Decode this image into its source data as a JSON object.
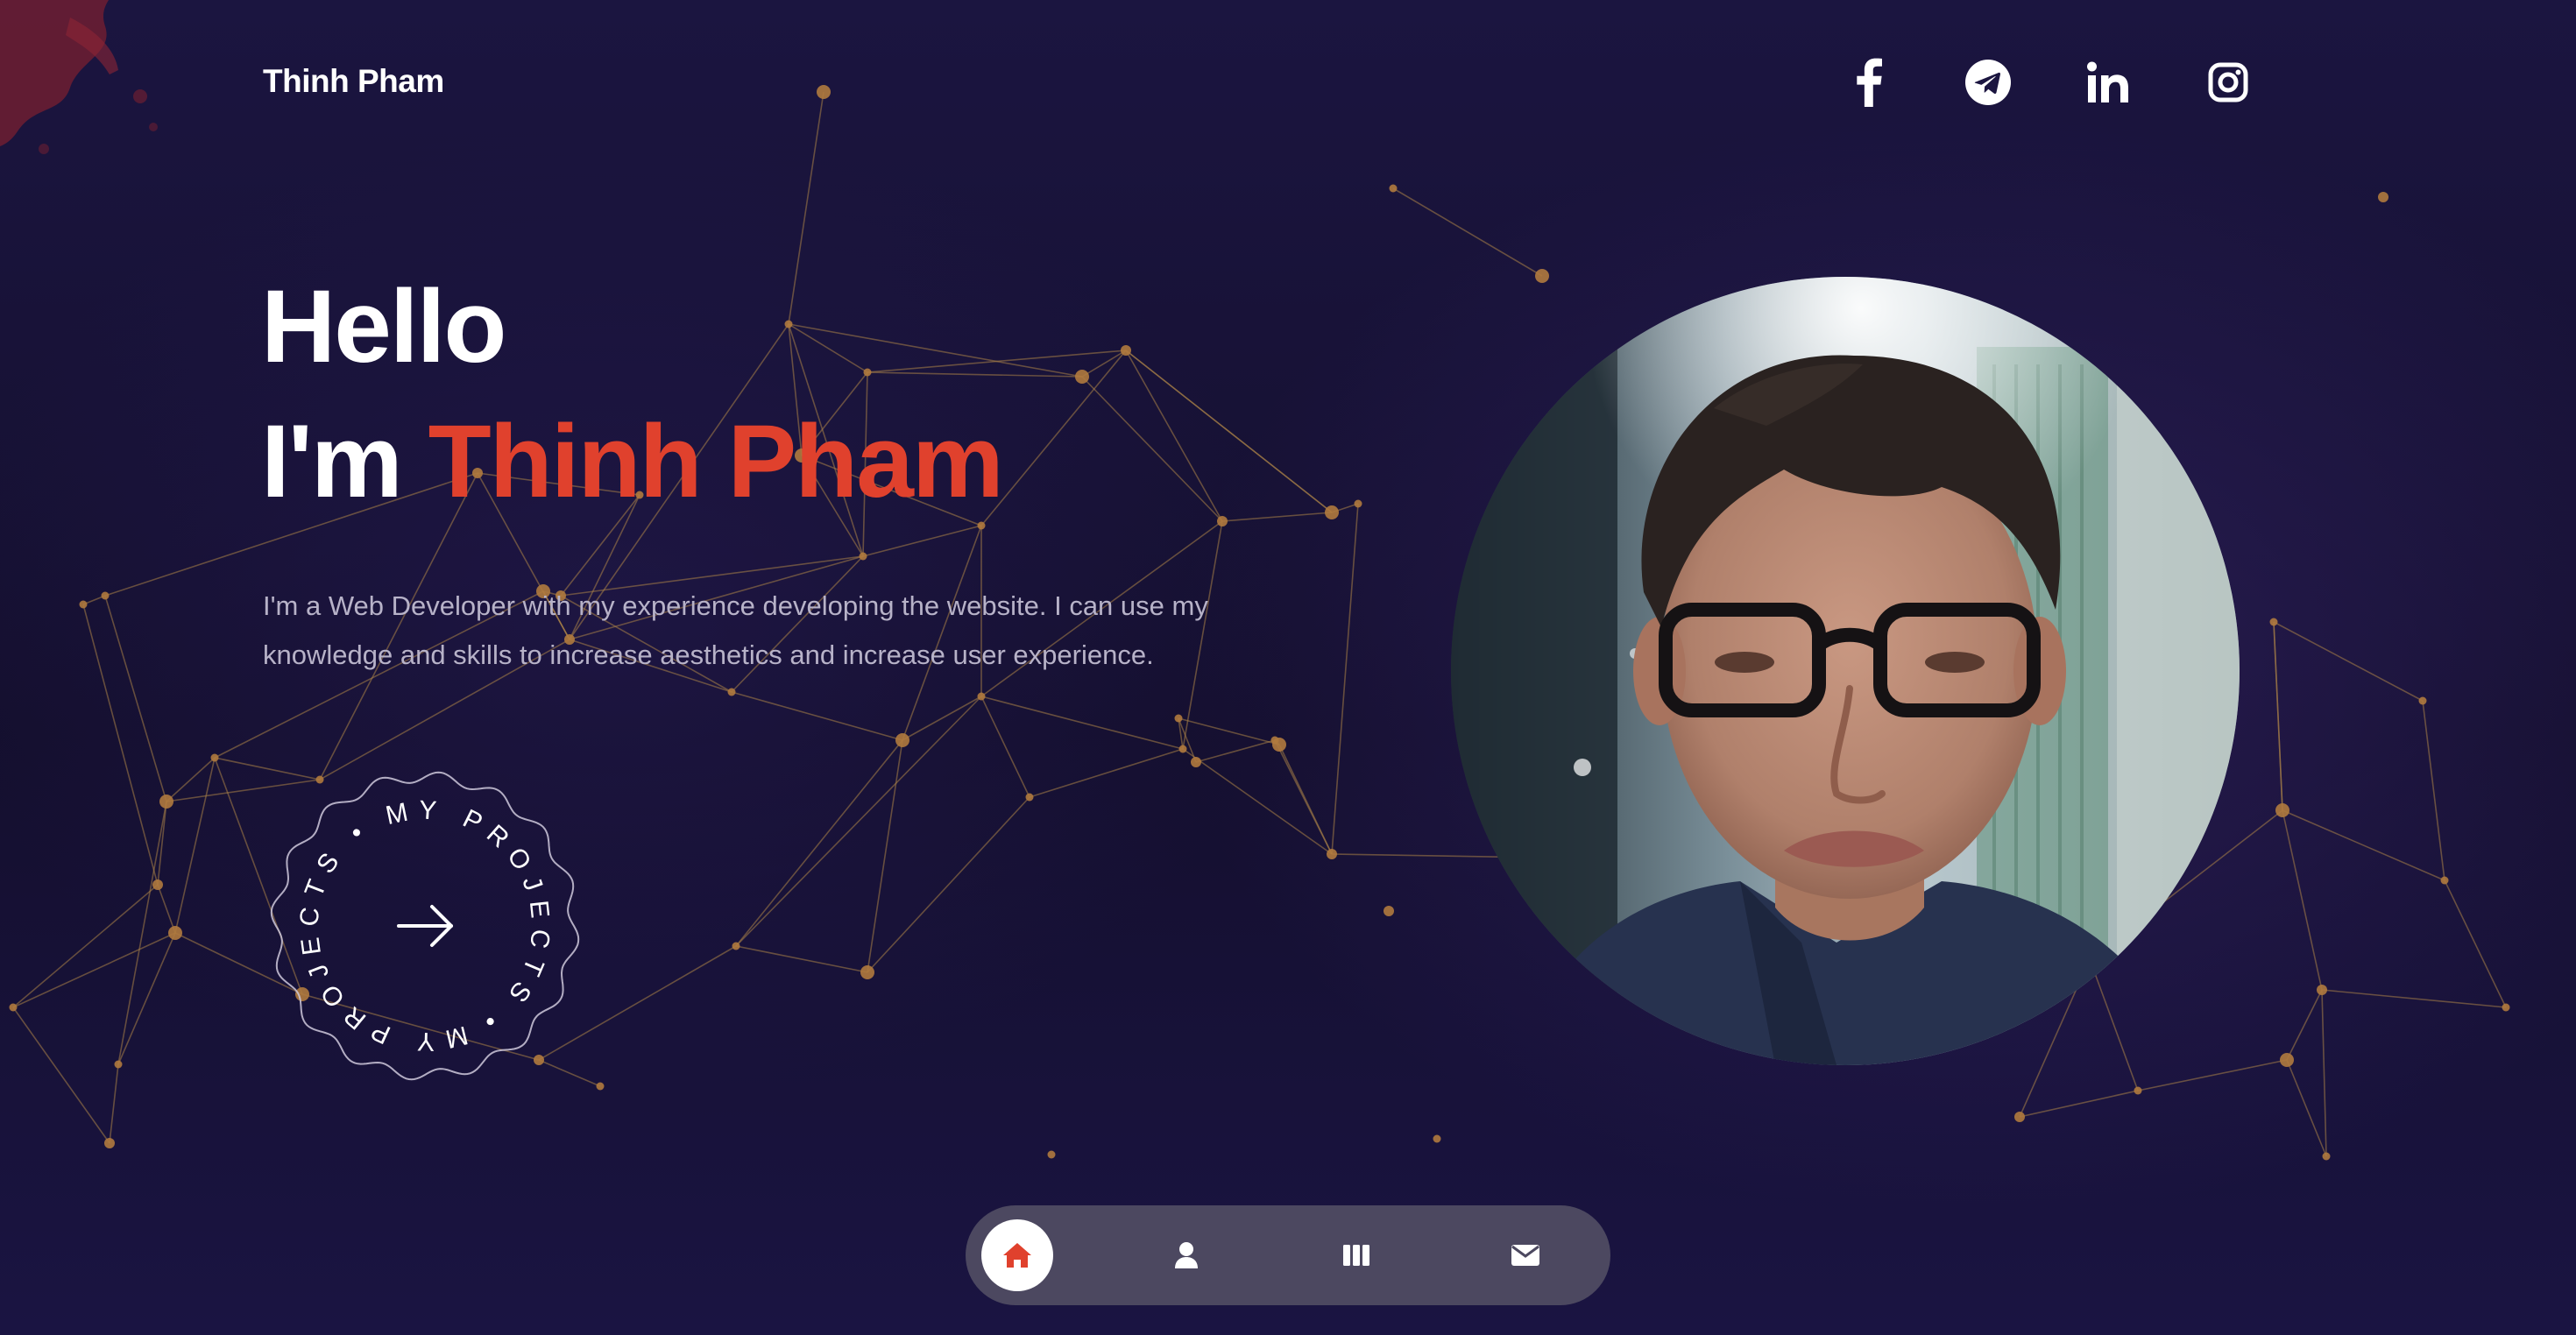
{
  "header": {
    "brand": "Thinh Pham",
    "social": [
      {
        "name": "facebook-icon"
      },
      {
        "name": "telegram-icon"
      },
      {
        "name": "linkedin-icon"
      },
      {
        "name": "instagram-icon"
      }
    ]
  },
  "hero": {
    "greeting": "Hello",
    "intro_prefix": "I'm ",
    "intro_name": "Thinh Pham",
    "description": "I'm a Web Developer with my experience developing the website. I can use my knowledge and skills to increase aesthetics and increase user experience."
  },
  "cta": {
    "circular_text": "MY PROJECTS • MY PROJECTS • ",
    "icon": "arrow-right-icon"
  },
  "dock": {
    "items": [
      {
        "name": "home-icon",
        "active": true
      },
      {
        "name": "user-icon",
        "active": false
      },
      {
        "name": "projects-icon",
        "active": false
      },
      {
        "name": "mail-icon",
        "active": false
      }
    ]
  },
  "colors": {
    "background": "#15102f",
    "accent": "#e0412d",
    "text": "#ffffff",
    "muted_text": "#b7b2c8",
    "network_line": "#a98147",
    "network_node": "#b07a3e",
    "dock_bg": "#4c4860"
  }
}
